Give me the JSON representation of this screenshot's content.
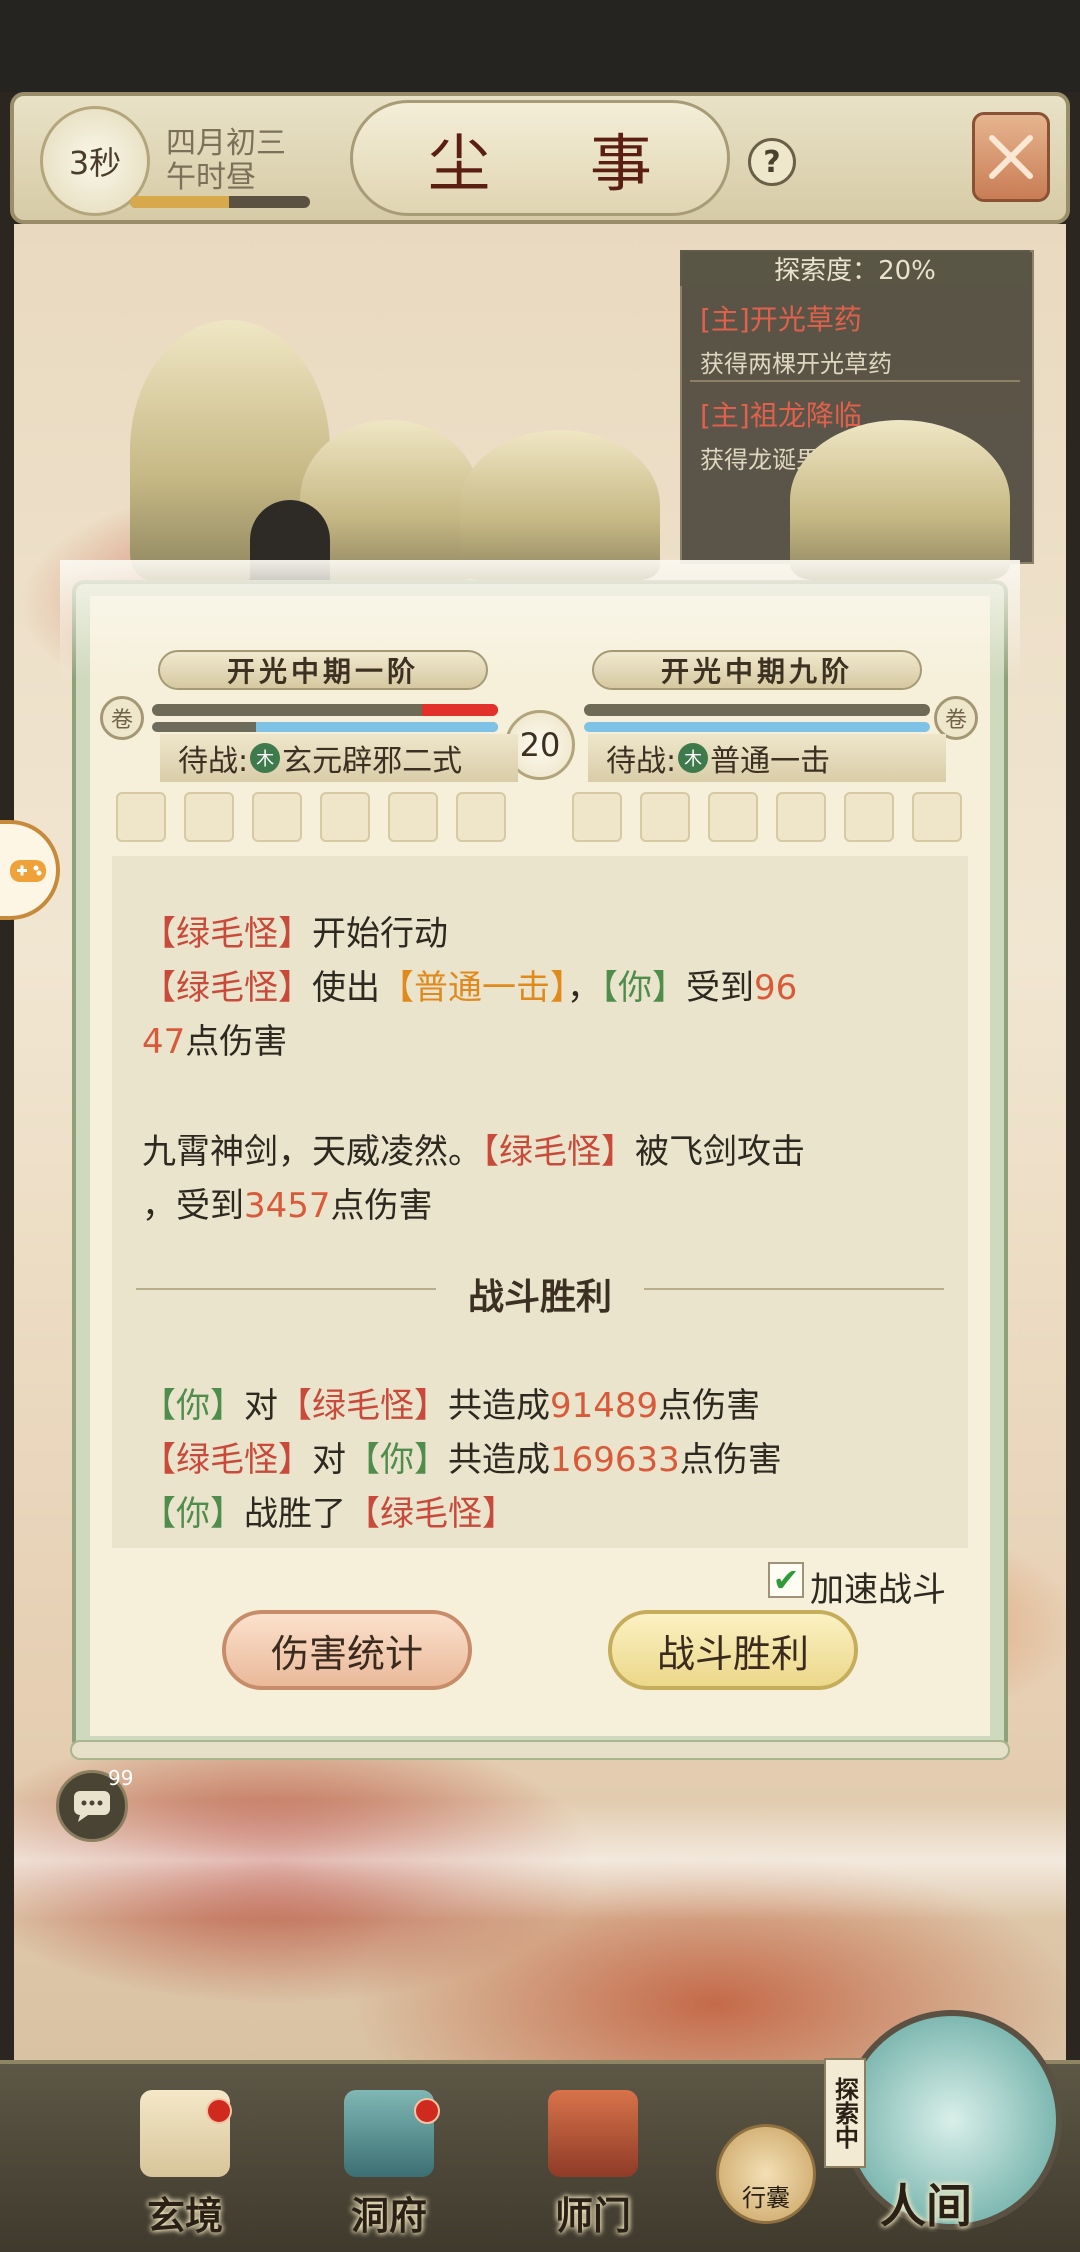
{
  "header": {
    "timer": "3秒",
    "date_line1": "四月初三",
    "date_line2": "午时昼",
    "title": "尘 事",
    "help_label": "?",
    "time_progress": 0.55
  },
  "quests": {
    "explore_label": "探索度：20%",
    "items": [
      {
        "title": "[主]开光草药",
        "desc": "获得两棵开光草药"
      },
      {
        "title": "[主]祖龙降临",
        "desc": "获得龙诞果"
      }
    ]
  },
  "battle": {
    "left": {
      "rank": "开光中期一阶",
      "waiting_prefix": "待战:",
      "element": "木",
      "skill": "玄元辟邪二式",
      "hp_ratio": 0.78,
      "mp_ratio": 0.3
    },
    "right": {
      "rank": "开光中期九阶",
      "waiting_prefix": "待战:",
      "element": "木",
      "skill": "普通一击",
      "hp_ratio": 1.0,
      "mp_ratio": 1.0
    },
    "round": "20",
    "log": {
      "l1_name": "【绿毛怪】",
      "l1_text": "开始行动",
      "l2_name": "【绿毛怪】",
      "l2_use": "使出",
      "l2_skill": "【普通一击】",
      "l2_comma": "，",
      "l2_you": "【你】",
      "l2_recv": "受到",
      "l2_num_a": "96",
      "l3_num_b": "47",
      "l3_text": "点伤害",
      "l4_text": "九霄神剑，天威凌然。",
      "l4_name": "【绿毛怪】",
      "l4_hit": "被飞剑攻击",
      "l5_prefix": "，受到",
      "l5_num": "3457",
      "l5_text": "点伤害"
    },
    "victory_title": "战斗胜利",
    "summary": {
      "s1_you": "【你】",
      "s1_to": "对",
      "s1_name": "【绿毛怪】",
      "s1_total": "共造成",
      "s1_num": "91489",
      "s1_text": "点伤害",
      "s2_name": "【绿毛怪】",
      "s2_to": "对",
      "s2_you": "【你】",
      "s2_total": "共造成",
      "s2_num": "169633",
      "s2_text": "点伤害",
      "s3_you": "【你】",
      "s3_won": "战胜了",
      "s3_name": "【绿毛怪】"
    },
    "speed_label": "加速战斗",
    "speed_checked": true,
    "btn_damage": "伤害统计",
    "btn_victory": "战斗胜利"
  },
  "chat": {
    "count": "99"
  },
  "nav": {
    "items": [
      {
        "label": "玄境"
      },
      {
        "label": "洞府"
      },
      {
        "label": "师门"
      }
    ],
    "bag_label": "行囊",
    "exploring_label": "探索中",
    "world_label": "人间"
  },
  "colors": {
    "enemy_name": "#c84a3a",
    "skill_name": "#e08a1e",
    "player_name": "#4f8d4c",
    "damage_number": "#d85a3a"
  }
}
